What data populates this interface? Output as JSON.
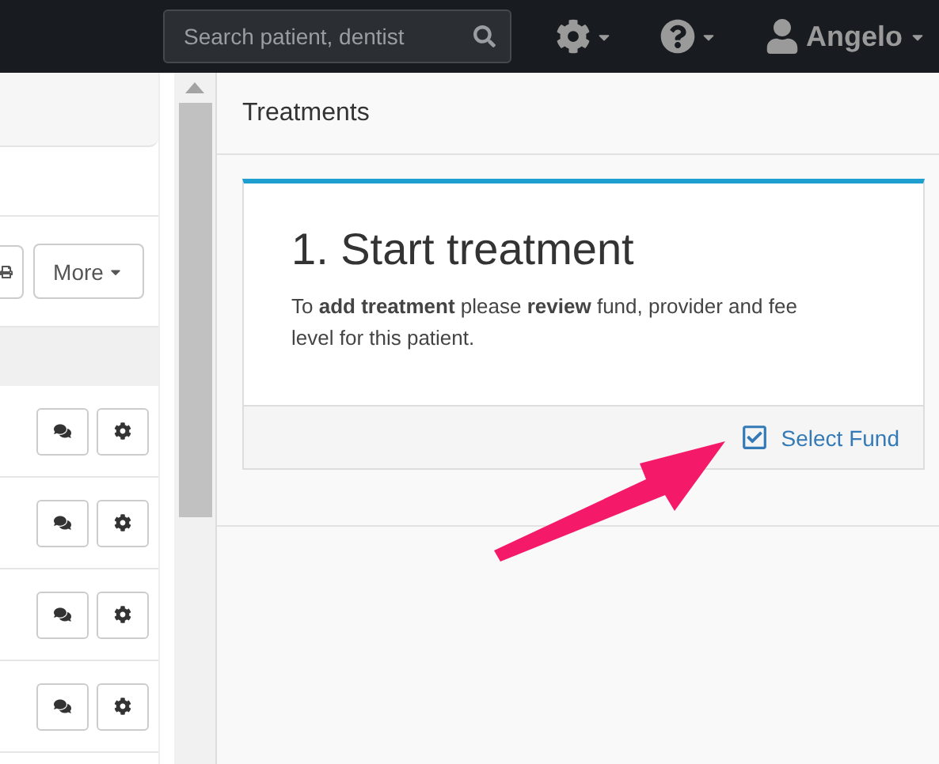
{
  "navbar": {
    "search": {
      "placeholder": "Search patient, dentist"
    },
    "menus": [
      {
        "kind": "settings"
      },
      {
        "kind": "help"
      }
    ],
    "user": {
      "name": "Angelo"
    }
  },
  "left_panel": {
    "toolbar": {
      "more_label": "More"
    },
    "rows": [
      {
        "actions": [
          {
            "kind": "comment"
          },
          {
            "kind": "settings"
          }
        ]
      },
      {
        "actions": [
          {
            "kind": "comment"
          },
          {
            "kind": "settings"
          }
        ]
      },
      {
        "actions": [
          {
            "kind": "comment"
          },
          {
            "kind": "settings"
          }
        ]
      },
      {
        "actions": [
          {
            "kind": "comment"
          },
          {
            "kind": "settings"
          }
        ]
      }
    ]
  },
  "treatments": {
    "title": "Treatments",
    "card": {
      "heading": "1. Start treatment",
      "text": "To **add treatment** please **review** fund, provider and fee level for this patient.",
      "link": "Select Fund"
    }
  }
}
